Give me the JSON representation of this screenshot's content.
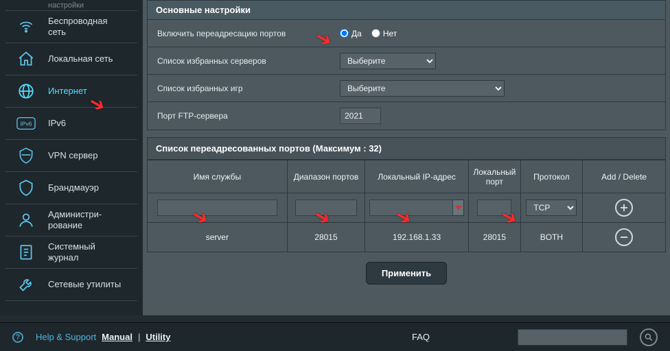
{
  "sidebar": {
    "truncated_label": "настройки",
    "items": [
      {
        "label": "Беспроводная\nсеть"
      },
      {
        "label": "Локальная сеть"
      },
      {
        "label": "Интернет"
      },
      {
        "label": "IPv6"
      },
      {
        "label": "VPN сервер"
      },
      {
        "label": "Брандмауэр"
      },
      {
        "label": "Администри-\nрование"
      },
      {
        "label": "Системный\nжурнал"
      },
      {
        "label": "Сетевые утилиты"
      }
    ],
    "active_index": 2
  },
  "main": {
    "panel_title": "Основные настройки",
    "rows": {
      "enable_label": "Включить переадресацию портов",
      "enable_yes": "Да",
      "enable_no": "Нет",
      "fav_servers_label": "Список избранных серверов",
      "fav_servers_value": "Выберите",
      "fav_games_label": "Список избранных игр",
      "fav_games_value": "Выберите",
      "ftp_port_label": "Порт FTP-сервера",
      "ftp_port_value": "2021"
    }
  },
  "port_section": {
    "header": "Список переадресованных портов (Максимум : 32)",
    "columns": {
      "service_name": "Имя службы",
      "port_range": "Диапазон портов",
      "local_ip": "Локальный IP-адрес",
      "local_port": "Локальный\nпорт",
      "protocol": "Протокол",
      "actions": "Add / Delete"
    },
    "input_row": {
      "protocol_value": "TCP"
    },
    "data_row": {
      "service_name": "server",
      "port_range": "28015",
      "local_ip": "192.168.1.33",
      "local_port": "28015",
      "protocol": "BOTH"
    }
  },
  "apply_button": "Применить",
  "footer": {
    "help_support": "Help & Support",
    "manual": "Manual",
    "utility": "Utility",
    "faq": "FAQ"
  }
}
